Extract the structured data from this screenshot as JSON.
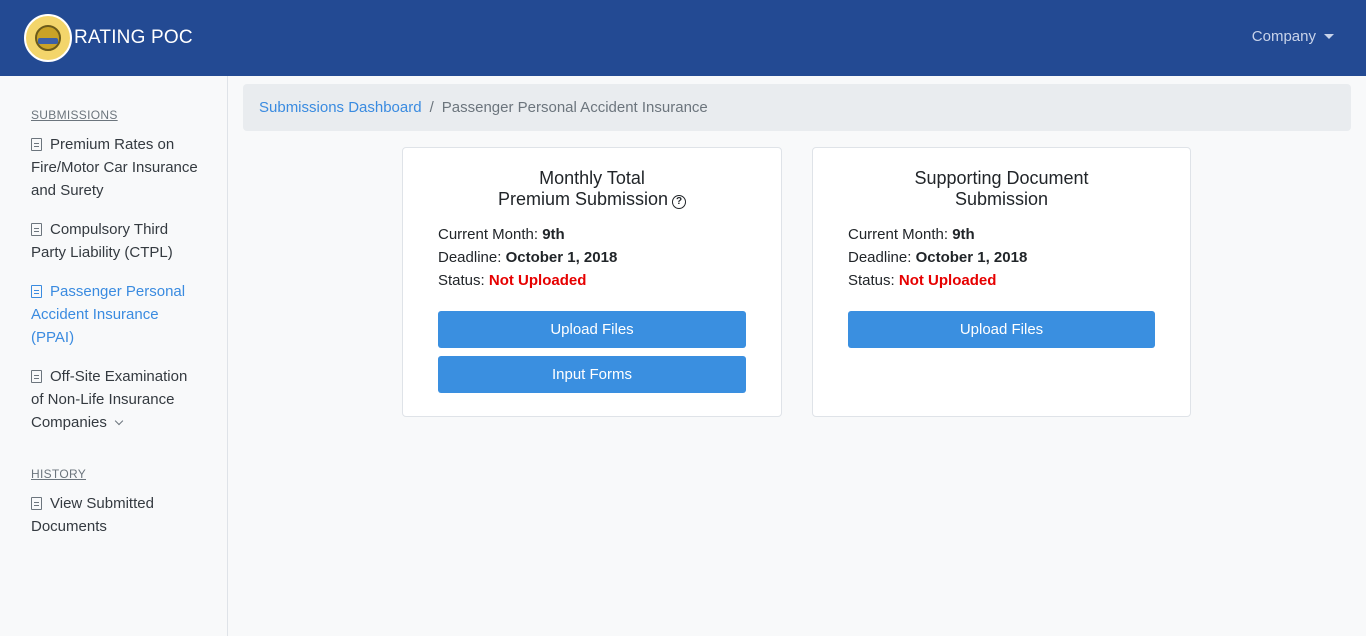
{
  "navbar": {
    "brand_title": "RATING POC",
    "company_menu": "Company"
  },
  "sidebar": {
    "submissions_heading": "SUBMISSIONS",
    "items": [
      {
        "label": "Premium Rates on Fire/Motor Car Insurance and Surety"
      },
      {
        "label": "Compulsory Third Party Liability (CTPL)"
      },
      {
        "label": "Passenger Personal Accident Insurance (PPAI)"
      },
      {
        "label": "Off-Site Examination of Non-Life Insurance Companies"
      }
    ],
    "history_heading": "HISTORY",
    "history_items": [
      {
        "label": "View Submitted Documents"
      }
    ]
  },
  "breadcrumb": {
    "link": "Submissions Dashboard",
    "separator": "/",
    "current": "Passenger Personal Accident Insurance"
  },
  "cards": [
    {
      "title_line1": "Monthly Total",
      "title_line2": "Premium Submission",
      "current_month_label": "Current Month:",
      "current_month_value": "9th",
      "deadline_label": "Deadline:",
      "deadline_value": "October 1, 2018",
      "status_label": "Status:",
      "status_value": "Not Uploaded",
      "upload_button": "Upload Files",
      "input_button": "Input Forms"
    },
    {
      "title_line1": "Supporting Document",
      "title_line2": "Submission",
      "current_month_label": "Current Month:",
      "current_month_value": "9th",
      "deadline_label": "Deadline:",
      "deadline_value": "October 1, 2018",
      "status_label": "Status:",
      "status_value": "Not Uploaded",
      "upload_button": "Upload Files"
    }
  ],
  "colors": {
    "navbar": "#234a93",
    "accent": "#3a8fe0",
    "status_error": "#e60000"
  }
}
